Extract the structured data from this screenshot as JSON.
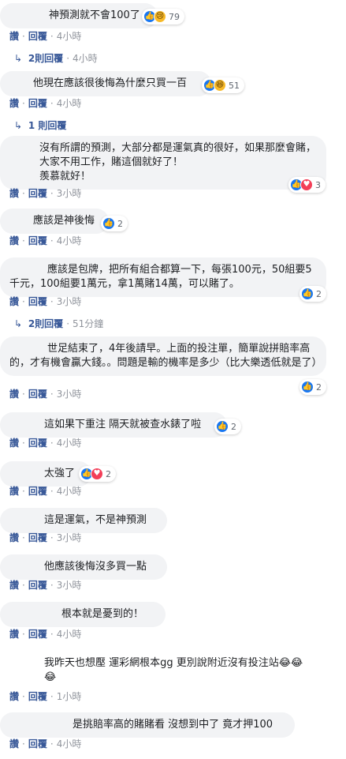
{
  "labels": {
    "like": "讚",
    "reply": "回覆",
    "dot": "·"
  },
  "icons": {
    "like": "thumbs-up-icon",
    "love": "heart-icon",
    "haha": "laugh-icon",
    "sad": "sad-icon",
    "reply_arrow": "reply-arrow-icon"
  },
  "colors": {
    "bubble": "#f2f3f5",
    "link": "#385898",
    "muted": "#90949c",
    "like": "#1877f2",
    "love": "#f33e58",
    "haha": "#f7b928"
  },
  "comments": [
    {
      "text": "神預測就不會100了",
      "time": "4小時",
      "reactions": [
        "like",
        "sad"
      ],
      "count": "79",
      "replies": {
        "label": "2則回覆",
        "time": "4小時"
      }
    },
    {
      "text": "他現在應該很後悔為什麼只買一百",
      "time": "4小時",
      "reactions": [
        "like",
        "haha"
      ],
      "count": "51",
      "replies": {
        "label": "1 則回覆",
        "time": ""
      }
    },
    {
      "text": "沒有所謂的預測，大部分都是運氣真的很好，如果那麼會賭，大家不用工作，賭這個就好了！\n羨慕就好！",
      "time": "3小時",
      "reactions": [
        "like",
        "love"
      ],
      "count": "3",
      "replies": null
    },
    {
      "text": "應該是神後悔",
      "time": "4小時",
      "reactions": [
        "like"
      ],
      "count": "2",
      "replies": null
    },
    {
      "text": "應該是包牌，把所有組合都算一下，每張100元，50組要5千元，100組要1萬元，拿1萬賭14萬，可以賭了。",
      "time": "3小時",
      "reactions": [
        "like"
      ],
      "count": "2",
      "replies": {
        "label": "2則回覆",
        "time": "51分鐘"
      }
    },
    {
      "text": "世足結束了，4年後請早。上面的投注單，簡單說拼賠率高的，才有機會贏大錢。。問題是輸的機率是多少（比大樂透低就是了）",
      "time": "3小時",
      "reactions": [
        "like"
      ],
      "count": "2",
      "replies": null
    },
    {
      "text": "這如果下重注 隔天就被查水錶了啦",
      "time": "4小時",
      "reactions": [
        "like"
      ],
      "count": "2",
      "replies": null
    },
    {
      "text": "太強了",
      "time": "4小時",
      "reactions": [
        "like",
        "love"
      ],
      "count": "2",
      "replies": null
    },
    {
      "text": "這是運氣，不是神預測",
      "time": "3小時",
      "reactions": [],
      "count": "",
      "replies": null
    },
    {
      "text": "他應該後悔沒多買一點",
      "time": "3小時",
      "reactions": [],
      "count": "",
      "replies": null
    },
    {
      "text": "根本就是憂到的！",
      "time": "4小時",
      "reactions": [],
      "count": "",
      "replies": null
    },
    {
      "text": "我昨天也想壓 運彩網根本gg 更別說附近沒有投注站😂😂😂",
      "time": "1小時",
      "reactions": [],
      "count": "",
      "replies": null
    },
    {
      "text": "是挑賠率高的賭賭看 沒想到中了 竟才押100",
      "time": "4小時",
      "reactions": [],
      "count": "",
      "replies": null
    }
  ]
}
